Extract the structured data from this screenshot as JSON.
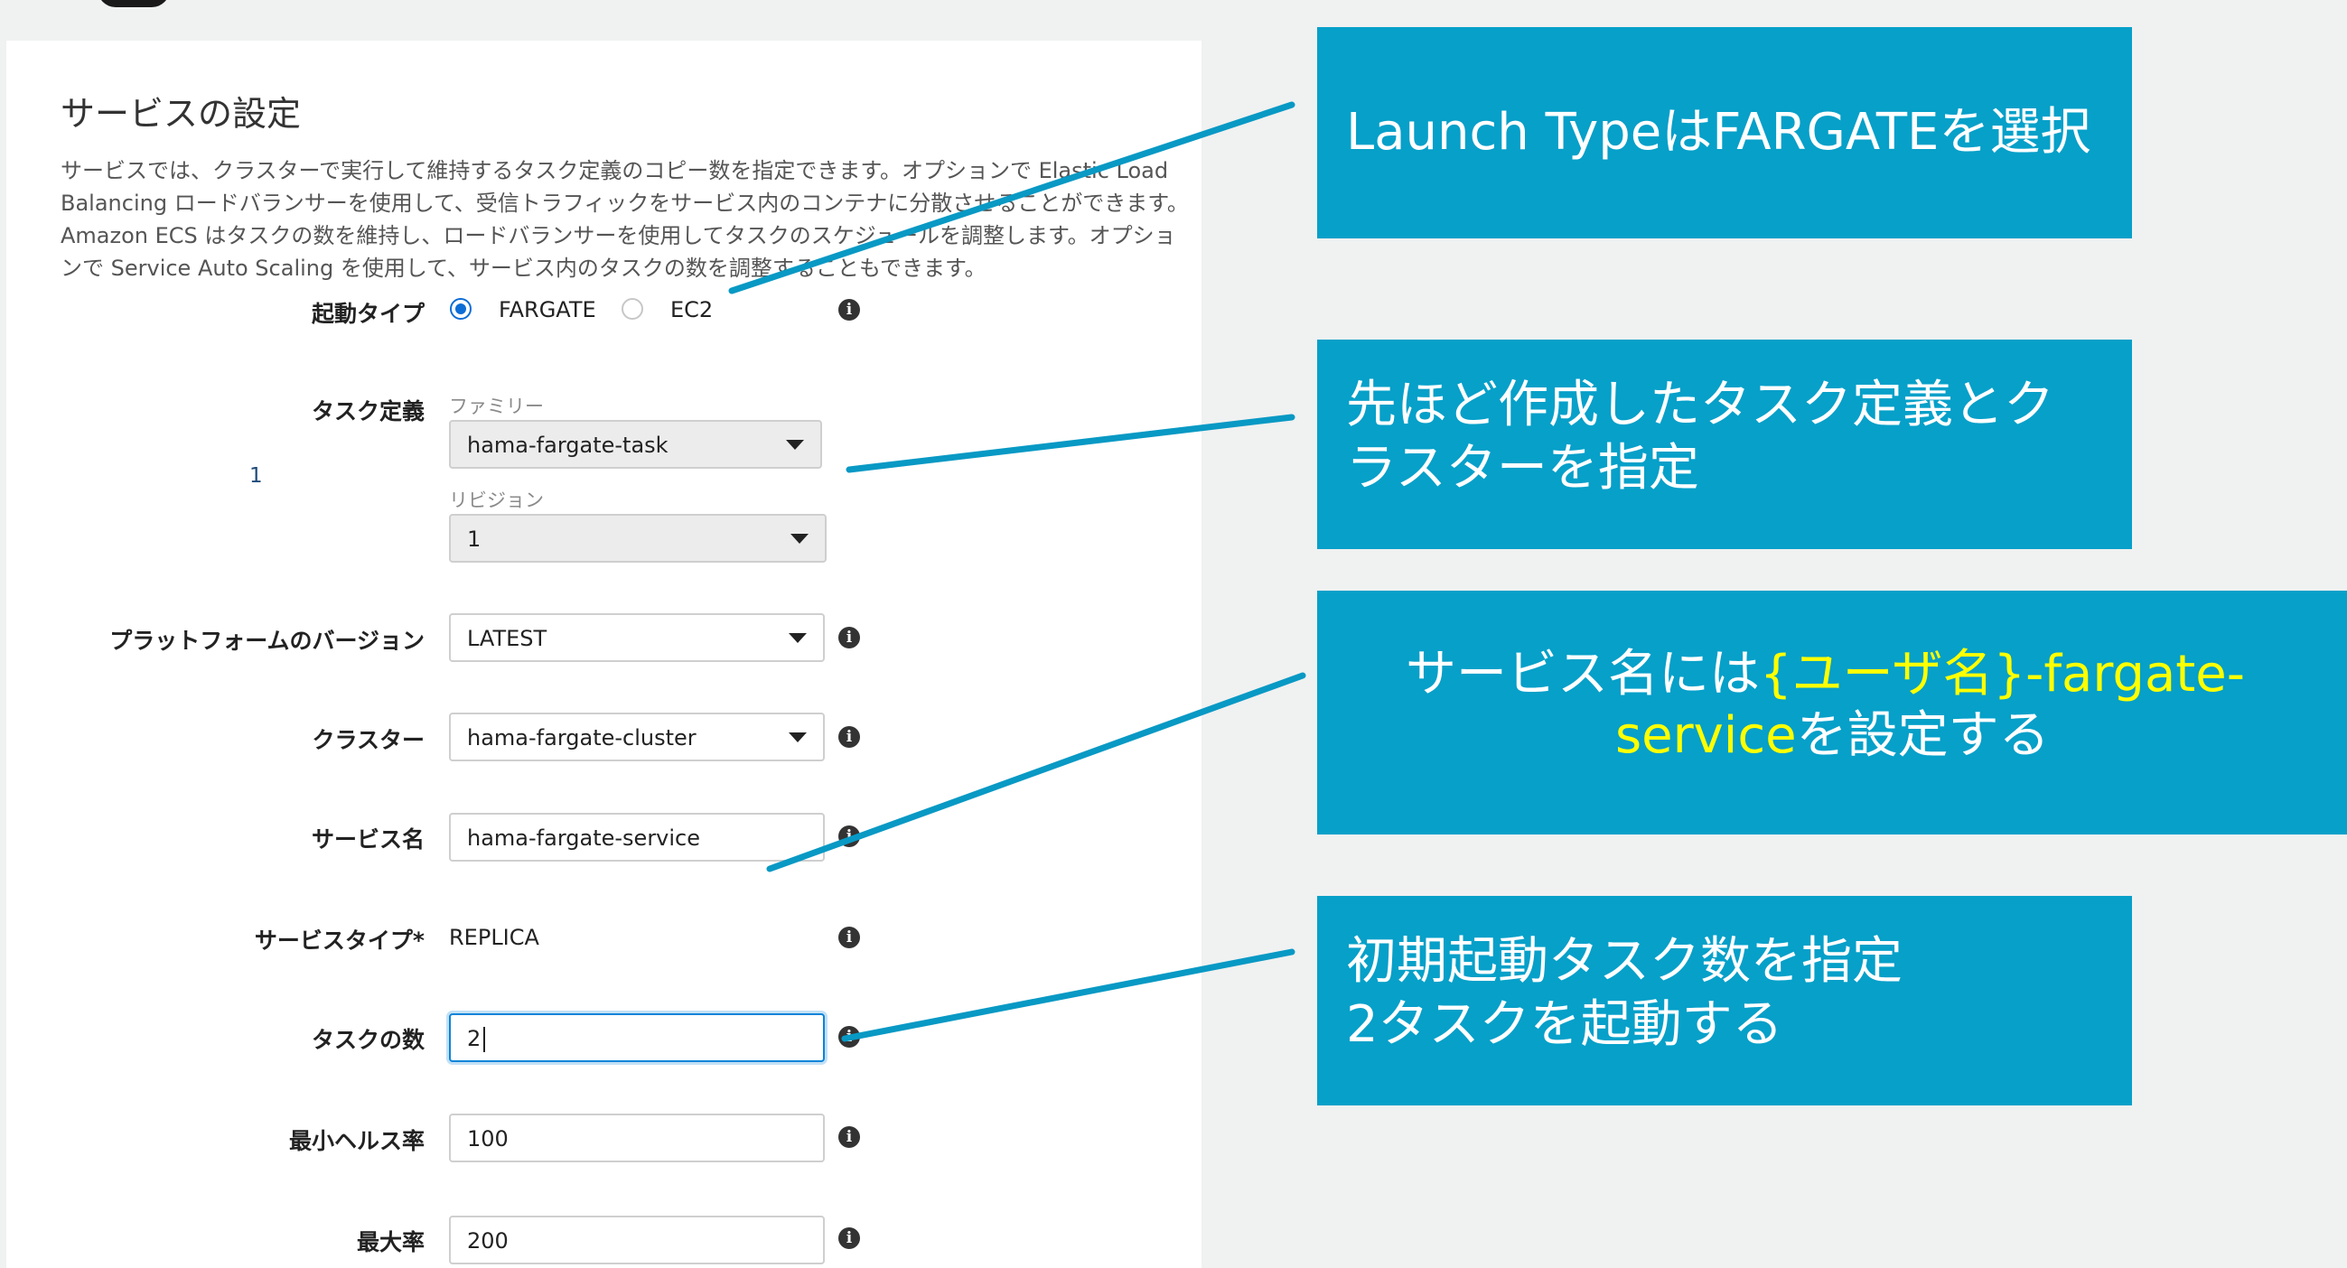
{
  "section": {
    "title": "サービスの設定",
    "description": "サービスでは、クラスターで実行して維持するタスク定義のコピー数を指定できます。オプションで Elastic Load Balancing ロードバランサーを使用して、受信トラフィックをサービス内のコンテナに分散させることができます。Amazon ECS はタスクの数を維持し、ロードバランサーを使用してタスクのスケジュールを調整します。オプションで Service Auto Scaling を使用して、サービス内のタスクの数を調整することもできます。"
  },
  "form": {
    "launch_type": {
      "label": "起動タイプ",
      "options": [
        "FARGATE",
        "EC2"
      ],
      "selected": "FARGATE"
    },
    "task_definition": {
      "label": "タスク定義",
      "side_number": "1",
      "family_label": "ファミリー",
      "family_value": "hama-fargate-task",
      "revision_label": "リビジョン",
      "revision_value": "1"
    },
    "platform_version": {
      "label": "プラットフォームのバージョン",
      "value": "LATEST"
    },
    "cluster": {
      "label": "クラスター",
      "value": "hama-fargate-cluster"
    },
    "service_name": {
      "label": "サービス名",
      "value": "hama-fargate-service"
    },
    "service_type": {
      "label": "サービスタイプ*",
      "value": "REPLICA"
    },
    "task_count": {
      "label": "タスクの数",
      "value": "2"
    },
    "min_health": {
      "label": "最小ヘルス率",
      "value": "100"
    },
    "max_percent": {
      "label": "最大率",
      "value": "200"
    },
    "info_icon": "i"
  },
  "callouts": {
    "launch": "Launch TypeはFARGATEを選択",
    "task_line1": "先ほど作成したタスク定義とク",
    "task_line2": "ラスターを指定",
    "service_line1_a": "サービス名には",
    "service_line1_b": "{ユーザ名}-fargate-",
    "service_line2_a": "service",
    "service_line2_b": "を設定する",
    "count_line1": "初期起動タスク数を指定",
    "count_line2": "2タスクを起動する"
  },
  "colors": {
    "callout_bg": "#06a0c9",
    "highlight_text": "#ffff00",
    "radio_selected": "#0d6dd6",
    "focus_border": "#0a84d8"
  }
}
